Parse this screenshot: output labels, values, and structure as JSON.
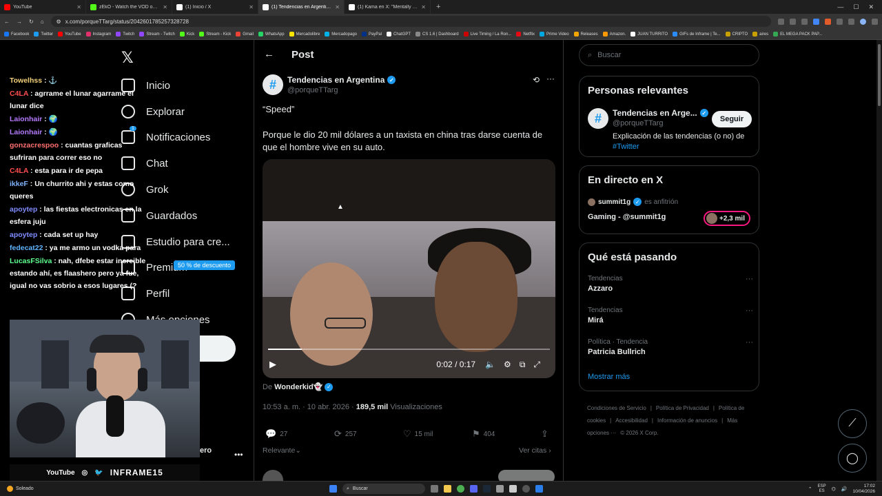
{
  "browser": {
    "tabs": [
      {
        "title": "YouTube",
        "color": "#ff0000"
      },
      {
        "title": "zEkO - Watch the VOD on Kick",
        "color": "#53fc18"
      },
      {
        "title": "(1) Inicio / X",
        "color": "#ffffff"
      },
      {
        "title": "(1) Tendencias en Argentin...",
        "color": "#ffffff"
      },
      {
        "title": "(1) Kama en X: \"Mentally I'm ha...",
        "color": "#ffffff"
      }
    ],
    "new_tab": "+",
    "url": "x.com/porqueTTarg/status/2042601785257328728",
    "bookmarks": [
      {
        "label": "Facebook",
        "color": "#1877f2"
      },
      {
        "label": "Twitter",
        "color": "#1d9bf0"
      },
      {
        "label": "YouTube",
        "color": "#ff0000"
      },
      {
        "label": "Instagram",
        "color": "#e1306c"
      },
      {
        "label": "Twitch",
        "color": "#9146ff"
      },
      {
        "label": "Stream - Twitch",
        "color": "#9146ff"
      },
      {
        "label": "Kick",
        "color": "#53fc18"
      },
      {
        "label": "Stream - Kick",
        "color": "#53fc18"
      },
      {
        "label": "Gmail",
        "color": "#ea4335"
      },
      {
        "label": "WhatsApp",
        "color": "#25d366"
      },
      {
        "label": "Mercadolibre",
        "color": "#ffe600"
      },
      {
        "label": "Mercadopago",
        "color": "#00b1ea"
      },
      {
        "label": "PayPal",
        "color": "#003087"
      },
      {
        "label": "ChatGPT",
        "color": "#ffffff"
      },
      {
        "label": "CS 1.6 | Dashboard",
        "color": "#888888"
      },
      {
        "label": "Live Timing / La Ron...",
        "color": "#cc0000"
      },
      {
        "label": "Netflix",
        "color": "#e50914"
      },
      {
        "label": "Prime Video",
        "color": "#00a8e1"
      },
      {
        "label": "Releases",
        "color": "#f0a500"
      },
      {
        "label": "Amazon.",
        "color": "#ff9900"
      },
      {
        "label": "JUAN TURRITO",
        "color": "#ffffff"
      },
      {
        "label": "GIFs de Inframe | Te...",
        "color": "#2a8cff"
      },
      {
        "label": "CRIPTO",
        "color": "#c8a000"
      },
      {
        "label": "aires",
        "color": "#c8a000"
      },
      {
        "label": "EL MEGA PACK PAP...",
        "color": "#34a853"
      }
    ]
  },
  "nav": {
    "items": [
      {
        "label": "Inicio",
        "icon": "home-icon"
      },
      {
        "label": "Explorar",
        "icon": "search-icon"
      },
      {
        "label": "Notificaciones",
        "icon": "bell-icon"
      },
      {
        "label": "Chat",
        "icon": "chat-icon"
      },
      {
        "label": "Grok",
        "icon": "grok-icon"
      },
      {
        "label": "Guardados",
        "icon": "bookmark-icon"
      },
      {
        "label": "Estudio para cre...",
        "icon": "rocket-icon"
      },
      {
        "label": "Premium",
        "icon": "x-icon"
      },
      {
        "label": "Perfil",
        "icon": "person-icon"
      },
      {
        "label": "Más opciones",
        "icon": "more-circle-icon"
      }
    ],
    "notif_badge": "1",
    "discount": "50 % de descuento",
    "side_text": "ero"
  },
  "chat": [
    {
      "user": "Towelhss",
      "color": "#f4d27a",
      "text": " : ⚓"
    },
    {
      "user": "C4LA",
      "color": "#ff4d4d",
      "text": " : agrrame el lunar agarrame el lunar dice"
    },
    {
      "user": "Laionhair",
      "color": "#b57bff",
      "text": " : 🌍"
    },
    {
      "user": "Laionhair",
      "color": "#b57bff",
      "text": " : 🌍"
    },
    {
      "user": "gonzacrespoo",
      "color": "#ff6f6f",
      "text": " : cuantas graficas sufriran para correr eso no"
    },
    {
      "user": "C4LA",
      "color": "#ff4d4d",
      "text": " : esta para ir de pepa"
    },
    {
      "user": "ikkeF",
      "color": "#7fb2ff",
      "text": " : Un churrito ahi y estas como queres"
    },
    {
      "user": "apoytep",
      "color": "#7f8cff",
      "text": " : las fiestas electronicas en la esfera juju"
    },
    {
      "user": "apoytep",
      "color": "#7f8cff",
      "text": " : cada set up hay"
    },
    {
      "user": "fedecat22",
      "color": "#5fb4ff",
      "text": " : ya me armo un vodka para"
    },
    {
      "user": "LucasFSilva",
      "color": "#5cff8f",
      "text": " : nah, dfebe estar increible estando ahí, es flaashero pero ya fue, igual no vas sobrio a esos lugares (?"
    }
  ],
  "branding": {
    "youtube": "YouTube",
    "name": "INFRAME15"
  },
  "post": {
    "header": "Post",
    "account_name": "Tendencias en Argentina",
    "handle": "@porqueTTarg",
    "quote": "“Speed”",
    "body": "Porque le dio 20 mil dólares a un taxista en china tras darse cuenta de que el hombre vive en su auto.",
    "video_time": "0:02 / 0:17",
    "video_progress": 0.12,
    "from_prefix": "De",
    "from_user": "Wonderkid👻",
    "time": "10:53 a. m. · 10 abr. 2026 · ",
    "views_count": "189,5 mil",
    "views_label": " Visualizaciones",
    "replies": "27",
    "reposts": "257",
    "likes": "15 mil",
    "bookmarks": "404",
    "sort_label": "Relevante",
    "quotes_label": "Ver citas"
  },
  "sidebar": {
    "search_placeholder": "Buscar",
    "relevant_title": "Personas relevantes",
    "rel_name": "Tendencias en Arge...",
    "rel_handle": "@porqueTTarg",
    "follow": "Seguir",
    "rel_bio": "Explicación de las tendencias (o no) de ",
    "rel_tag": "#Twitter",
    "live_title": "En directo en X",
    "live_host": "summit1g",
    "live_role": "es anfitrión",
    "live_show": "Gaming - @summit1g",
    "live_count": "+2,3 mil",
    "trending_title": "Qué está pasando",
    "trends": [
      {
        "category": "Tendencias",
        "name": "Azzaro"
      },
      {
        "category": "Tendencias",
        "name": "Mirá"
      },
      {
        "category": "Política · Tendencia",
        "name": "Patricia Bullrich"
      }
    ],
    "show_more": "Mostrar más",
    "footer": [
      "Condiciones de Servicio",
      "|",
      "Política de Privacidad",
      "|",
      "Política de cookies",
      "|",
      "Accesibilidad",
      "|",
      "Información de anuncios",
      "|",
      "Más opciones ···",
      "© 2026 X Corp."
    ]
  },
  "taskbar": {
    "weather": "Soleado",
    "search": "Buscar",
    "lang1": "ESP",
    "lang2": "ES",
    "time": "17:02",
    "date": "10/04/2026"
  }
}
